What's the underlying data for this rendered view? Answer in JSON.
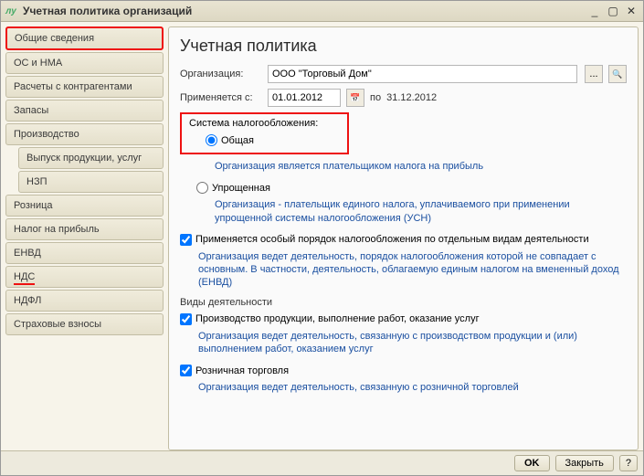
{
  "window": {
    "title": "Учетная политика организаций"
  },
  "sidebar": {
    "items": [
      {
        "label": "Общие сведения"
      },
      {
        "label": "ОС и НМА"
      },
      {
        "label": "Расчеты с контрагентами"
      },
      {
        "label": "Запасы"
      },
      {
        "label": "Производство"
      },
      {
        "label": "Выпуск продукции, услуг"
      },
      {
        "label": "НЗП"
      },
      {
        "label": "Розница"
      },
      {
        "label": "Налог на прибыль"
      },
      {
        "label": "ЕНВД"
      },
      {
        "label": "НДС"
      },
      {
        "label": "НДФЛ"
      },
      {
        "label": "Страховые взносы"
      }
    ]
  },
  "main": {
    "title": "Учетная политика",
    "org_label": "Организация:",
    "org_value": "ООО \"Торговый Дом\"",
    "apply_label": "Применяется с:",
    "date_from": "01.01.2012",
    "date_to_label": "по",
    "date_to": "31.12.2012",
    "tax_system": {
      "title": "Система налогообложения:",
      "general": "Общая",
      "general_desc": "Организация является плательщиком налога на прибыль",
      "simplified": "Упрощенная",
      "simplified_desc": "Организация - плательщик единого налога, уплачиваемого при применении упрощенной системы налогообложения (УСН)"
    },
    "special": {
      "label": "Применяется особый порядок налогообложения по отдельным видам деятельности",
      "desc": "Организация ведет деятельность, порядок налогообложения которой не совпадает с основным. В частности, деятельность, облагаемую единым налогом на вмененный доход (ЕНВД)"
    },
    "activities": {
      "title": "Виды деятельности",
      "prod": "Производство продукции, выполнение работ, оказание услуг",
      "prod_desc": "Организация ведет деятельность, связанную с производством продукции и (или) выполнением работ, оказанием услуг",
      "retail": "Розничная торговля",
      "retail_desc": "Организация ведет деятельность, связанную с розничной торговлей"
    }
  },
  "footer": {
    "ok": "OK",
    "close": "Закрыть"
  },
  "icons": {
    "ellipsis": "...",
    "search": "🔍",
    "calendar": "📅",
    "help": "?"
  }
}
